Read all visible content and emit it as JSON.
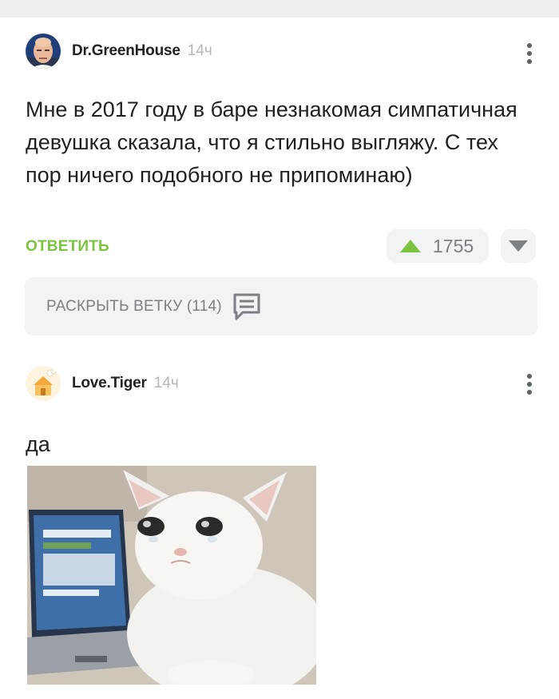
{
  "comments": [
    {
      "username": "Dr.GreenHouse",
      "time": "14ч",
      "text": "Мне в 2017 году в баре незнакомая симпатичная девушка сказала, что я стильно выгляжу. С тех пор ничего подобного не припоминаю)",
      "reply_label": "ОТВЕТИТЬ",
      "rating": "1755",
      "expand_label": "РАСКРЫТЬ ВЕТКУ (114)",
      "avatar_icon": "bald-man-avatar"
    },
    {
      "username": "Love.Tiger",
      "time": "14ч",
      "text": "да",
      "avatar_icon": "cartoon-house-avatar",
      "image_icon": "crying-cat-meme-image"
    }
  ],
  "colors": {
    "accent_green": "#7cc440",
    "panel_gray": "#f2f3f4",
    "muted_text": "#7a8085"
  }
}
